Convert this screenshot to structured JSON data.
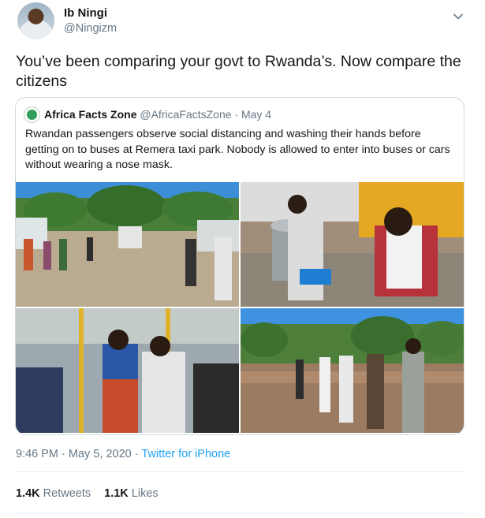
{
  "author": {
    "display_name": "Ib Ningi",
    "handle": "@Ningizm",
    "avatar_icon": "user-avatar"
  },
  "tweet": {
    "text": "You’ve been comparing your govt to Rwanda’s. Now compare the citizens"
  },
  "quoted_tweet": {
    "display_name": "Africa Facts Zone",
    "handle": "@AfricaFactsZone",
    "separator": "·",
    "date": "May 4",
    "text": "Rwandan passengers observe social distancing and washing their hands before getting on to buses at Remera taxi park. Nobody is allowed to enter into buses or cars without wearing a nose mask.",
    "photos": [
      "bus-queue-photo",
      "hand-washing-photo",
      "bus-interior-photo",
      "street-queue-photo"
    ]
  },
  "meta": {
    "time": "9:46 PM",
    "separator": "·",
    "date": "May 5, 2020",
    "source": "Twitter for iPhone"
  },
  "stats": {
    "retweets_count": "1.4K",
    "retweets_label": "Retweets",
    "likes_count": "1.1K",
    "likes_label": "Likes"
  },
  "colors": {
    "link": "#1da1f2",
    "secondary_text": "#657786",
    "border": "#cfd9de"
  }
}
